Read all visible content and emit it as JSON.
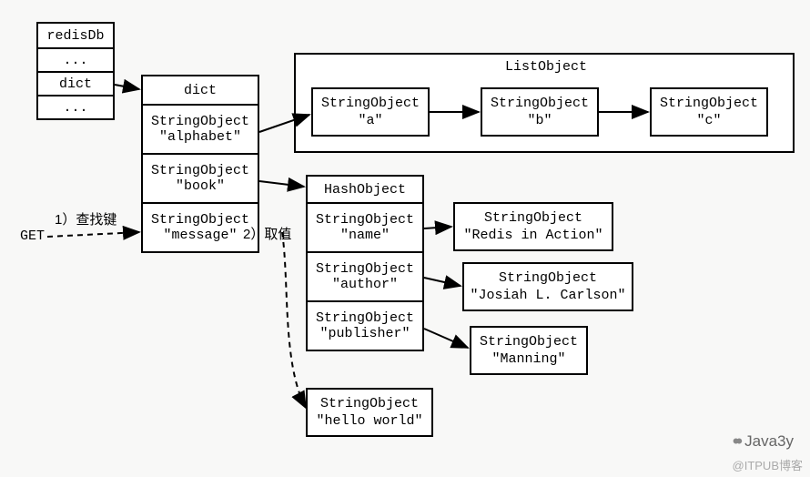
{
  "redisdb": {
    "title": "redisDb",
    "cells": [
      "...",
      "dict",
      "..."
    ]
  },
  "dict_col": {
    "title": "dict",
    "keys": [
      {
        "type": "StringObject",
        "value": "\"alphabet\""
      },
      {
        "type": "StringObject",
        "value": "\"book\""
      },
      {
        "type": "StringObject",
        "value": "\"message\""
      }
    ]
  },
  "list_object": {
    "title": "ListObject",
    "items": [
      {
        "type": "StringObject",
        "value": "\"a\""
      },
      {
        "type": "StringObject",
        "value": "\"b\""
      },
      {
        "type": "StringObject",
        "value": "\"c\""
      }
    ]
  },
  "hash_object": {
    "title": "HashObject",
    "fields": [
      {
        "key_type": "StringObject",
        "key_value": "\"name\"",
        "val_type": "StringObject",
        "val_value": "\"Redis in Action\""
      },
      {
        "key_type": "StringObject",
        "key_value": "\"author\"",
        "val_type": "StringObject",
        "val_value": "\"Josiah L. Carlson\""
      },
      {
        "key_type": "StringObject",
        "key_value": "\"publisher\"",
        "val_type": "StringObject",
        "val_value": "\"Manning\""
      }
    ]
  },
  "message_value": {
    "type": "StringObject",
    "value": "\"hello world\""
  },
  "steps": {
    "step1": "1）查找键",
    "step2": "2）取值",
    "get": "GET"
  },
  "watermarks": {
    "java3y": "Java3y",
    "itpub": "@ITPUB博客"
  }
}
